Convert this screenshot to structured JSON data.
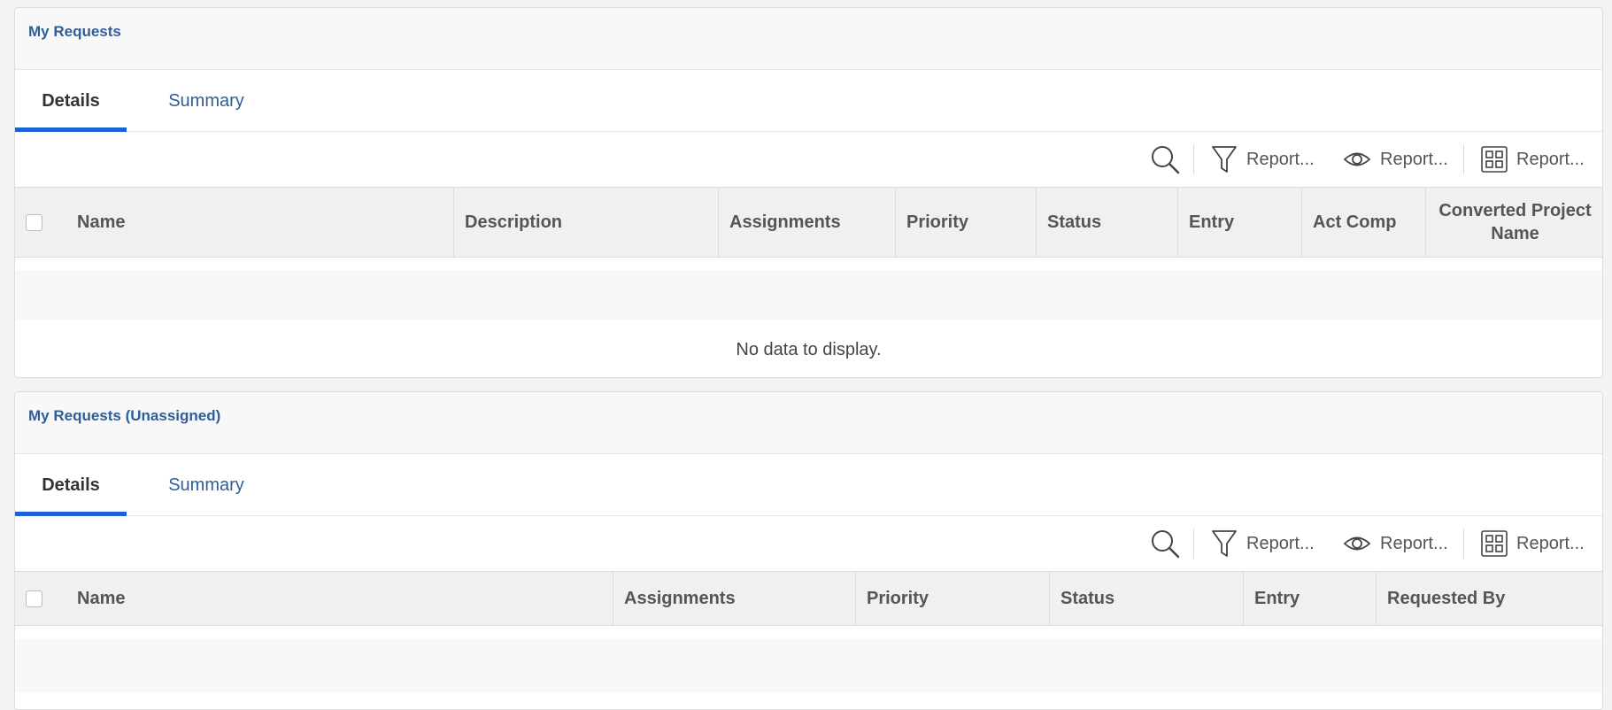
{
  "panels": [
    {
      "title": "My Requests",
      "tabs": [
        {
          "label": "Details",
          "active": true
        },
        {
          "label": "Summary",
          "active": false
        }
      ],
      "toolbar": {
        "filter_label": "Report...",
        "view_label": "Report...",
        "grouping_label": "Report..."
      },
      "columns": [
        "Name",
        "Description",
        "Assignments",
        "Priority",
        "Status",
        "Entry",
        "Act Comp",
        "Converted Project Name"
      ],
      "empty_message": "No data to display."
    },
    {
      "title": "My Requests (Unassigned)",
      "tabs": [
        {
          "label": "Details",
          "active": true
        },
        {
          "label": "Summary",
          "active": false
        }
      ],
      "toolbar": {
        "filter_label": "Report...",
        "view_label": "Report...",
        "grouping_label": "Report..."
      },
      "columns": [
        "Name",
        "Assignments",
        "Priority",
        "Status",
        "Entry",
        "Requested By"
      ]
    }
  ],
  "icons": {
    "search": "search-icon",
    "filter": "filter-icon",
    "view": "eye-icon",
    "grouping": "grid-icon"
  },
  "colors": {
    "title": "#2f5d98",
    "active_tab_underline": "#1a63d6",
    "header_bg": "#f0f0f0"
  }
}
